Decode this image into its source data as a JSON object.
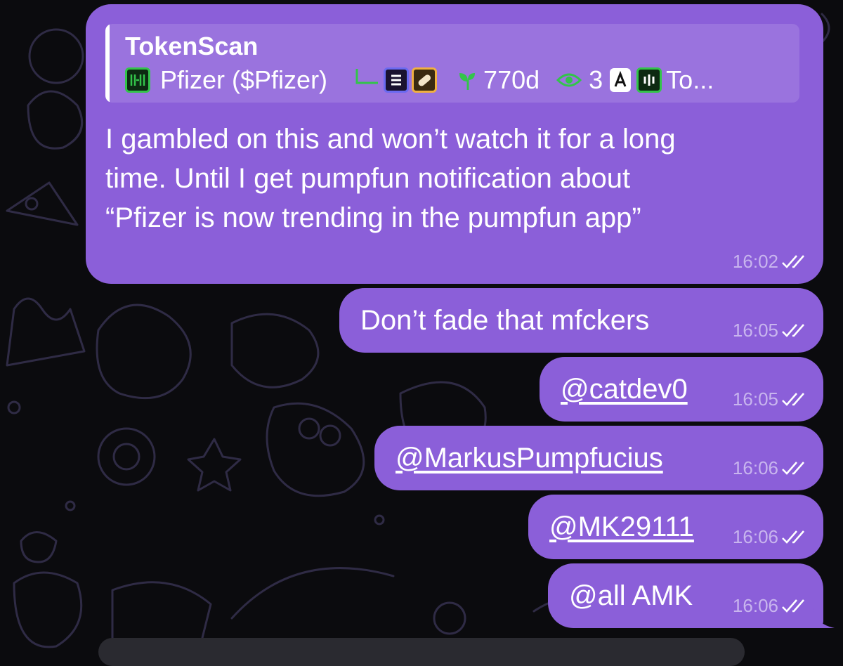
{
  "messages": [
    {
      "quote": {
        "author": "TokenScan",
        "token_name": "Pfizer ($Pfizer)",
        "age": "770d",
        "views": "3",
        "trailing": "To..."
      },
      "lines": [
        "I gambled on this and won’t watch it for a long",
        "time. Until I get pumpfun notification about",
        "“Pfizer is now trending in the pumpfun app”"
      ],
      "time": "16:02",
      "status": "read-double-check"
    },
    {
      "text": "Don’t fade that mfckers",
      "time": "16:05",
      "status": "read-double-check"
    },
    {
      "text": "@catdev0",
      "time": "16:05",
      "status": "read-double-check",
      "is_mention": true
    },
    {
      "text": "@MarkusPumpfucius",
      "time": "16:06",
      "status": "read-double-check",
      "is_mention": true
    },
    {
      "text": "@MK29111",
      "time": "16:06",
      "status": "read-double-check",
      "is_mention": true
    },
    {
      "text": "@all AMK",
      "time": "16:06",
      "status": "read-double-check"
    }
  ],
  "colors": {
    "bubble": "#8b5fd9",
    "background": "#0b0b0e",
    "meta_text": "#c8b5ee",
    "token_green": "#33c44a"
  },
  "icons": [
    "token-logo-icon",
    "tree-branch-icon",
    "solana-icon",
    "pill-icon",
    "sprout-icon",
    "eye-icon",
    "app-icon",
    "chart-bars-icon",
    "double-check-icon"
  ]
}
